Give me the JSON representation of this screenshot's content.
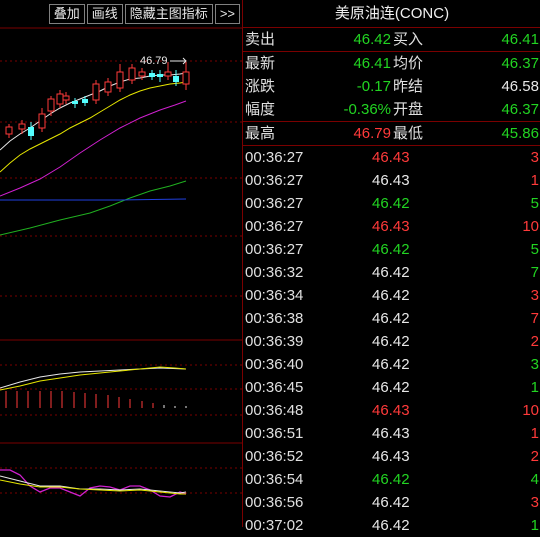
{
  "toolbar": {
    "overlay": "叠加",
    "draw": "画线",
    "hide_indicator": "隐藏主图指标",
    "more": ">>"
  },
  "chart": {
    "peak_label": "46.79"
  },
  "quote": {
    "title": "美原油连(CONC)",
    "rows": [
      {
        "l1": "卖出",
        "v1": "46.42",
        "c1": "#22d422",
        "l2": "买入",
        "v2": "46.41",
        "c2": "#22d422"
      },
      {
        "l1": "最新",
        "v1": "46.41",
        "c1": "#22d422",
        "l2": "均价",
        "v2": "46.37",
        "c2": "#22d422"
      },
      {
        "l1": "涨跌",
        "v1": "-0.17",
        "c1": "#22d422",
        "l2": "昨结",
        "v2": "46.58",
        "c2": "#e8e8e8"
      },
      {
        "l1": "幅度",
        "v1": "-0.36%",
        "c1": "#22d422",
        "l2": "开盘",
        "v2": "46.37",
        "c2": "#22d422"
      },
      {
        "l1": "最高",
        "v1": "46.79",
        "c1": "#ff3a3a",
        "l2": "最低",
        "v2": "45.86",
        "c2": "#22d422"
      }
    ]
  },
  "trades": [
    {
      "time": "00:36:27",
      "price": "46.43",
      "vol": "3",
      "pc": "#ff3a3a",
      "vc": "#ff3a3a"
    },
    {
      "time": "00:36:27",
      "price": "46.43",
      "vol": "1",
      "pc": "#e8e8e8",
      "vc": "#ff3a3a"
    },
    {
      "time": "00:36:27",
      "price": "46.42",
      "vol": "5",
      "pc": "#22d422",
      "vc": "#22d422"
    },
    {
      "time": "00:36:27",
      "price": "46.43",
      "vol": "10",
      "pc": "#ff3a3a",
      "vc": "#ff3a3a"
    },
    {
      "time": "00:36:27",
      "price": "46.42",
      "vol": "5",
      "pc": "#22d422",
      "vc": "#22d422"
    },
    {
      "time": "00:36:32",
      "price": "46.42",
      "vol": "7",
      "pc": "#e8e8e8",
      "vc": "#22d422"
    },
    {
      "time": "00:36:34",
      "price": "46.42",
      "vol": "3",
      "pc": "#e8e8e8",
      "vc": "#ff3a3a"
    },
    {
      "time": "00:36:38",
      "price": "46.42",
      "vol": "7",
      "pc": "#e8e8e8",
      "vc": "#ff3a3a"
    },
    {
      "time": "00:36:39",
      "price": "46.42",
      "vol": "2",
      "pc": "#e8e8e8",
      "vc": "#ff3a3a"
    },
    {
      "time": "00:36:40",
      "price": "46.42",
      "vol": "3",
      "pc": "#e8e8e8",
      "vc": "#22d422"
    },
    {
      "time": "00:36:45",
      "price": "46.42",
      "vol": "1",
      "pc": "#e8e8e8",
      "vc": "#22d422"
    },
    {
      "time": "00:36:48",
      "price": "46.43",
      "vol": "10",
      "pc": "#ff3a3a",
      "vc": "#ff3a3a"
    },
    {
      "time": "00:36:51",
      "price": "46.43",
      "vol": "1",
      "pc": "#e8e8e8",
      "vc": "#ff3a3a"
    },
    {
      "time": "00:36:52",
      "price": "46.43",
      "vol": "2",
      "pc": "#e8e8e8",
      "vc": "#ff3a3a"
    },
    {
      "time": "00:36:54",
      "price": "46.42",
      "vol": "4",
      "pc": "#22d422",
      "vc": "#22d422"
    },
    {
      "time": "00:36:56",
      "price": "46.42",
      "vol": "3",
      "pc": "#e8e8e8",
      "vc": "#ff3a3a"
    },
    {
      "time": "00:37:02",
      "price": "46.42",
      "vol": "1",
      "pc": "#e8e8e8",
      "vc": "#22d422"
    }
  ]
}
